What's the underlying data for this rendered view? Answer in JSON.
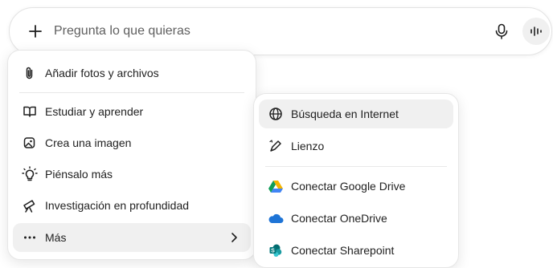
{
  "prompt": {
    "placeholder": "Pregunta lo que quieras",
    "value": ""
  },
  "main_menu": {
    "items": [
      {
        "label": "Añadir fotos y archivos",
        "icon": "paperclip-icon"
      },
      {
        "label": "Estudiar y aprender",
        "icon": "book-icon"
      },
      {
        "label": "Crea una imagen",
        "icon": "image-icon"
      },
      {
        "label": "Piénsalo más",
        "icon": "lightbulb-icon"
      },
      {
        "label": "Investigación en profundidad",
        "icon": "telescope-icon"
      },
      {
        "label": "Más",
        "icon": "more-dots-icon",
        "has_submenu": true
      }
    ]
  },
  "sub_menu": {
    "items": [
      {
        "label": "Búsqueda en Internet",
        "icon": "globe-icon"
      },
      {
        "label": "Lienzo",
        "icon": "pen-icon"
      },
      {
        "label": "Conectar Google Drive",
        "icon": "google-drive-icon"
      },
      {
        "label": "Conectar OneDrive",
        "icon": "onedrive-icon"
      },
      {
        "label": "Conectar Sharepoint",
        "icon": "sharepoint-icon"
      }
    ]
  },
  "colors": {
    "highlight": "#f0f0f0",
    "drive_green": "#0f9d58",
    "drive_yellow": "#f4b400",
    "drive_blue": "#4285f4",
    "onedrive_blue": "#1e74d6",
    "sharepoint_teal": "#038387"
  }
}
